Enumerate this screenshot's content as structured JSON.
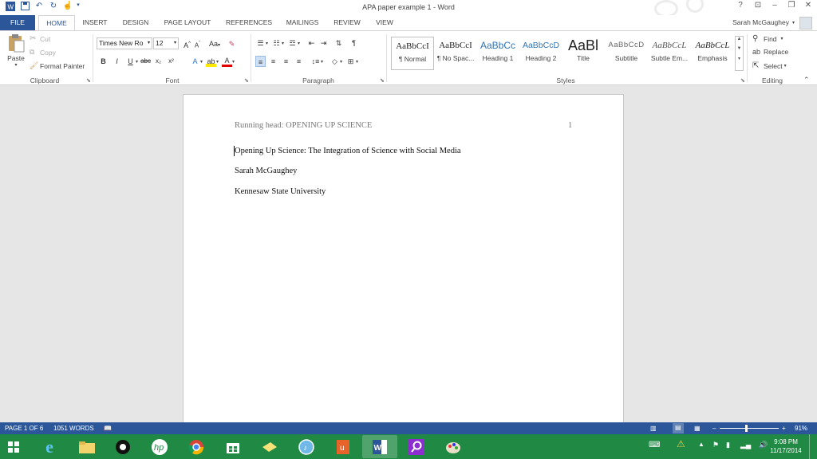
{
  "window": {
    "title": "APA paper example 1 - Word",
    "user": "Sarah McGaughey",
    "help": "?",
    "controls": [
      "?",
      "⊡",
      "–",
      "❐",
      "✕"
    ]
  },
  "tabs": [
    "FILE",
    "HOME",
    "INSERT",
    "DESIGN",
    "PAGE LAYOUT",
    "REFERENCES",
    "MAILINGS",
    "REVIEW",
    "VIEW"
  ],
  "clipboard": {
    "paste": "Paste",
    "cut": "Cut",
    "copy": "Copy",
    "format_painter": "Format Painter",
    "label": "Clipboard"
  },
  "font": {
    "name": "Times New Ro",
    "size": "12",
    "grow": "A",
    "shrink": "A",
    "case": "Aa",
    "bold": "B",
    "italic": "I",
    "underline": "U",
    "strike": "abc",
    "sub": "x₂",
    "sup": "x²",
    "label": "Font"
  },
  "paragraph": {
    "label": "Paragraph",
    "pilcrow": "¶"
  },
  "styles": {
    "label": "Styles",
    "items": [
      {
        "preview": "AaBbCcI",
        "name": "¶ Normal"
      },
      {
        "preview": "AaBbCcI",
        "name": "¶ No Spac..."
      },
      {
        "preview": "AaBbCc",
        "name": "Heading 1"
      },
      {
        "preview": "AaBbCcD",
        "name": "Heading 2"
      },
      {
        "preview": "AaBl",
        "name": "Title"
      },
      {
        "preview": "AaBbCcD",
        "name": "Subtitle"
      },
      {
        "preview": "AaBbCcL",
        "name": "Subtle Em..."
      },
      {
        "preview": "AaBbCcL",
        "name": "Emphasis"
      }
    ]
  },
  "editing": {
    "find": "Find",
    "replace": "Replace",
    "select": "Select",
    "label": "Editing"
  },
  "document": {
    "running_head": "Running head: OPENING UP SCIENCE",
    "page_number": "1",
    "title": "Opening Up Science: The Integration of Science with Social Media",
    "author": "Sarah McGaughey",
    "institution": "Kennesaw State University"
  },
  "status": {
    "page": "PAGE 1 OF 6",
    "words": "1051 WORDS",
    "zoom": "91%",
    "zoom_minus": "–",
    "zoom_plus": "+"
  },
  "taskbar": {
    "time": "9:08 PM",
    "date": "11/17/2014",
    "apps": [
      "start",
      "internet-explorer",
      "file-explorer",
      "media",
      "hp",
      "chrome",
      "store",
      "windows-live",
      "itunes",
      "office",
      "word",
      "search",
      "paint"
    ],
    "active_app": "word"
  },
  "colors": {
    "word_blue": "#2b579a",
    "taskbar_green": "#208a45"
  }
}
